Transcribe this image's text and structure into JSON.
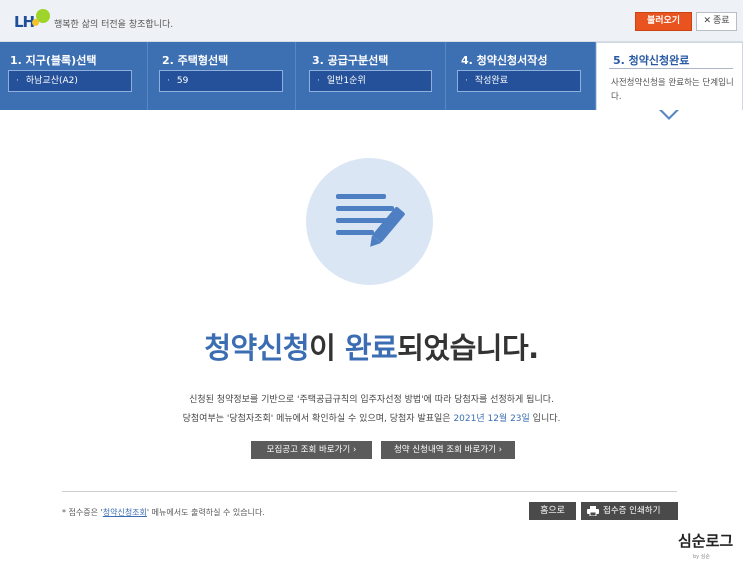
{
  "header": {
    "logo_text": "LH",
    "slogan": "행복한 삶의 터전을 창조합니다.",
    "load_button": "불러오기",
    "close_button": "종료",
    "close_icon": "close-icon"
  },
  "steps": [
    {
      "title": "1. 지구(블록)선택",
      "value": "하남교산(A2)"
    },
    {
      "title": "2. 주택형선택",
      "value": "59"
    },
    {
      "title": "3. 공급구분선택",
      "value": "일반1순위"
    },
    {
      "title": "4. 청약신청서작성",
      "value": "작성완료"
    },
    {
      "title": "5. 청약신청완료",
      "desc": "사전청약신청을 완료하는 단계입니다."
    }
  ],
  "main": {
    "illustration_icon": "document-pen-icon",
    "headline": {
      "part1": "청약신청",
      "part2": "이 ",
      "part3": "완료",
      "part4": "되었습니다."
    },
    "line1": "신청된 청약정보를 기반으로 '주택공급규칙의 입주자선정 방법'에 따라 당첨자를 선정하게 됩니다.",
    "line2_before": "당첨여부는 '당첨자조회' 메뉴에서 확인하실 수 있으며, 당첨자 발표일은 ",
    "line2_date": "2021년 12월 23일",
    "line2_after": " 입니다.",
    "btn_notice": "모집공고 조회 바로가기 ›",
    "btn_history": "청약 신청내역 조회 바로가기 ›"
  },
  "footer": {
    "note_before": "* 접수증은 '",
    "note_link": "청약신청조회",
    "note_after": "' 메뉴에서도 출력하실 수 있습니다.",
    "home_button": "홈으로",
    "print_button": "접수증 인쇄하기",
    "print_icon": "printer-icon"
  },
  "watermark": {
    "main": "심순로그",
    "sub": "by 심순"
  },
  "colors": {
    "primary_blue": "#3d6fb3",
    "accent_orange": "#e8531f",
    "dark_button": "#4a4a4a"
  }
}
